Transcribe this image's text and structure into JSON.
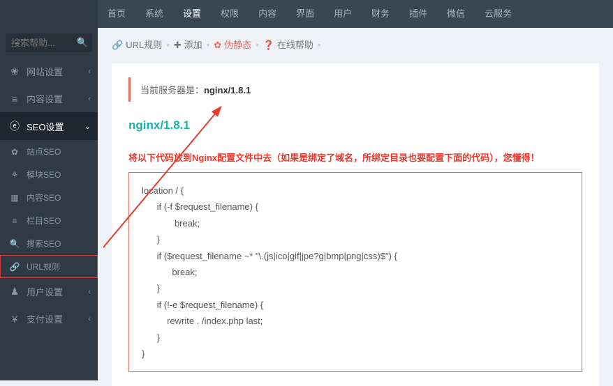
{
  "topnav": [
    "首页",
    "系统",
    "设置",
    "权限",
    "内容",
    "界面",
    "用户",
    "财务",
    "插件",
    "微信",
    "云服务"
  ],
  "topnav_active": 2,
  "search_placeholder": "搜索帮助...",
  "sidebar": {
    "items": [
      {
        "icon": "❀",
        "label": "网站设置",
        "chev": "‹"
      },
      {
        "icon": "≡",
        "label": "内容设置",
        "chev": "‹"
      },
      {
        "icon": "ⓔ",
        "label": "SEO设置",
        "chev": "⌄",
        "expanded": true
      },
      {
        "icon": "♟",
        "label": "用户设置",
        "chev": "‹"
      },
      {
        "icon": "¥",
        "label": "支付设置",
        "chev": "‹"
      }
    ],
    "seo_sub": [
      {
        "icon": "✿",
        "label": "站点SEO"
      },
      {
        "icon": "⚘",
        "label": "模块SEO"
      },
      {
        "icon": "▦",
        "label": "内容SEO"
      },
      {
        "icon": "≡",
        "label": "栏目SEO"
      },
      {
        "icon": "🔍",
        "label": "搜索SEO"
      },
      {
        "icon": "🔗",
        "label": "URL规则",
        "highlight": true
      }
    ]
  },
  "breadcrumb": [
    {
      "icon": "🔗",
      "label": "URL规则",
      "cls": ""
    },
    {
      "icon": "✚",
      "label": "添加",
      "cls": ""
    },
    {
      "icon": "✿",
      "label": "伪静态",
      "cls": "active"
    },
    {
      "icon": "❓",
      "label": "在线帮助",
      "cls": ""
    }
  ],
  "server_note_prefix": "当前服务器是：",
  "server_note_value": "nginx/1.8.1",
  "heading": "nginx/1.8.1",
  "warn": "将以下代码放到Nginx配置文件中去（如果是绑定了域名，所绑定目录也要配置下面的代码），您懂得！",
  "code": "location / {\n      if (-f $request_filename) {\n             break;\n      }\n      if ($request_filename ~* \"\\.(js|ico|gif|jpe?g|bmp|png|css)$\") {\n            break;\n      }\n      if (!-e $request_filename) {\n          rewrite . /index.php last;\n      }\n}"
}
